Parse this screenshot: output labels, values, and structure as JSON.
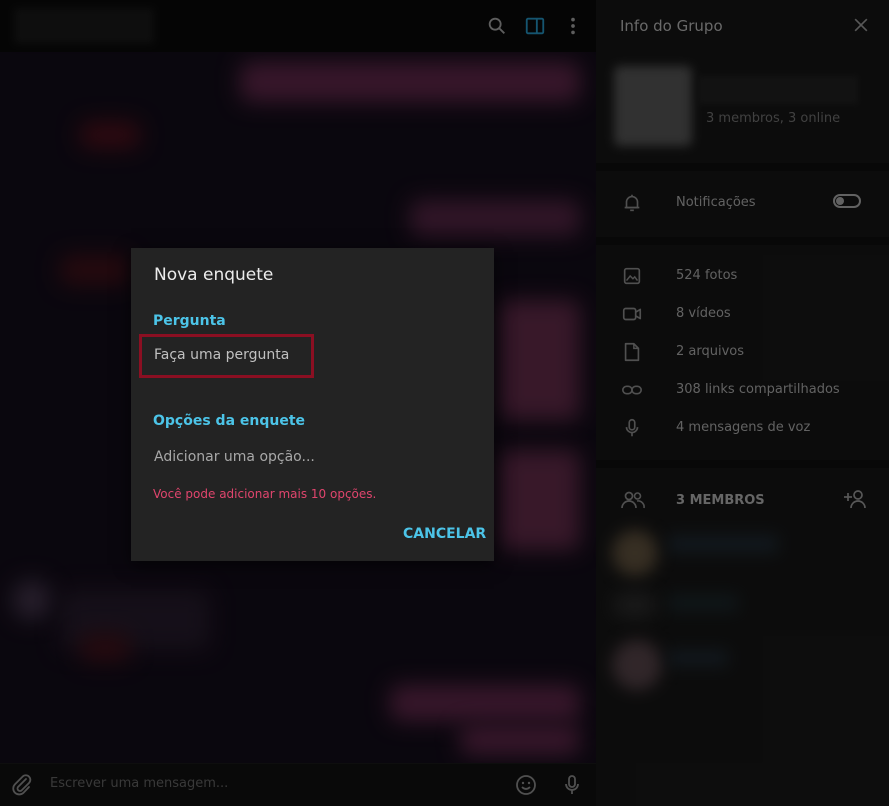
{
  "header": {
    "icons": [
      "search-icon",
      "side-panel-icon",
      "more-vertical-icon"
    ],
    "accent": "#2aa4d6"
  },
  "composer": {
    "placeholder": "Escrever uma mensagem...",
    "icons": [
      "attach-icon",
      "emoji-icon",
      "microphone-icon"
    ]
  },
  "side_panel": {
    "title": "Info do Grupo",
    "members_status": "3 membros, 3 online",
    "notifications": {
      "label": "Notificações",
      "enabled": false
    },
    "media": [
      {
        "icon": "photo-icon",
        "label": "524 fotos"
      },
      {
        "icon": "video-icon",
        "label": "8 vídeos"
      },
      {
        "icon": "file-icon",
        "label": "2 arquivos"
      },
      {
        "icon": "link-icon",
        "label": "308 links compartilhados"
      },
      {
        "icon": "microphone-icon",
        "label": "4 mensagens de voz"
      }
    ],
    "members_header": "3 MEMBROS"
  },
  "dialog": {
    "title": "Nova enquete",
    "question_label": "Pergunta",
    "question_placeholder": "Faça uma pergunta",
    "options_label": "Opções da enquete",
    "option_placeholder": "Adicionar uma opção...",
    "hint": "Você pode adicionar mais 10 opções.",
    "cancel_label": "CANCELAR",
    "accent": "#4cc4e8",
    "hint_color": "#e0456d",
    "highlight_color": "#8b0f22"
  }
}
